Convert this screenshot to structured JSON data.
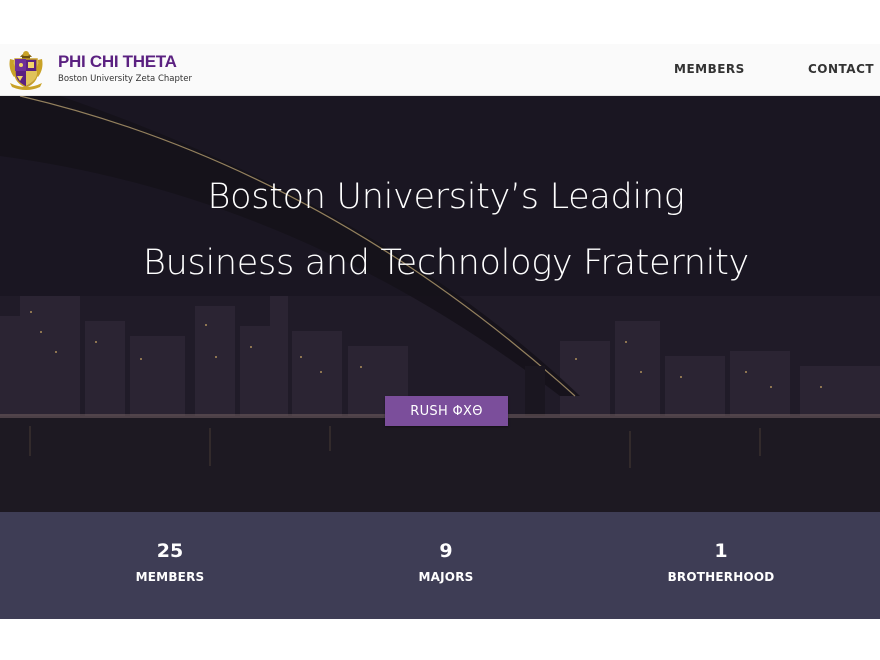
{
  "navbar": {
    "brand_title": "PHI CHI THETA",
    "brand_subtitle": "Boston University Zeta Chapter",
    "links": [
      {
        "label": "MEMBERS"
      },
      {
        "label": "CONTACT"
      }
    ]
  },
  "hero": {
    "title": "Boston University’s Leading Business and Technology Fraternity",
    "cta_label": "RUSH ΦΧΘ"
  },
  "stats": [
    {
      "value": "25",
      "label": "MEMBERS"
    },
    {
      "value": "9",
      "label": "MAJORS"
    },
    {
      "value": "1",
      "label": "BROTHERHOOD"
    }
  ],
  "colors": {
    "brand_purple": "#5b2181",
    "button_purple": "#7b4e9b",
    "stats_background": "#3e3d55",
    "navbar_background": "#fafafa"
  },
  "icons": {
    "crest": "fraternity-crest-icon"
  }
}
